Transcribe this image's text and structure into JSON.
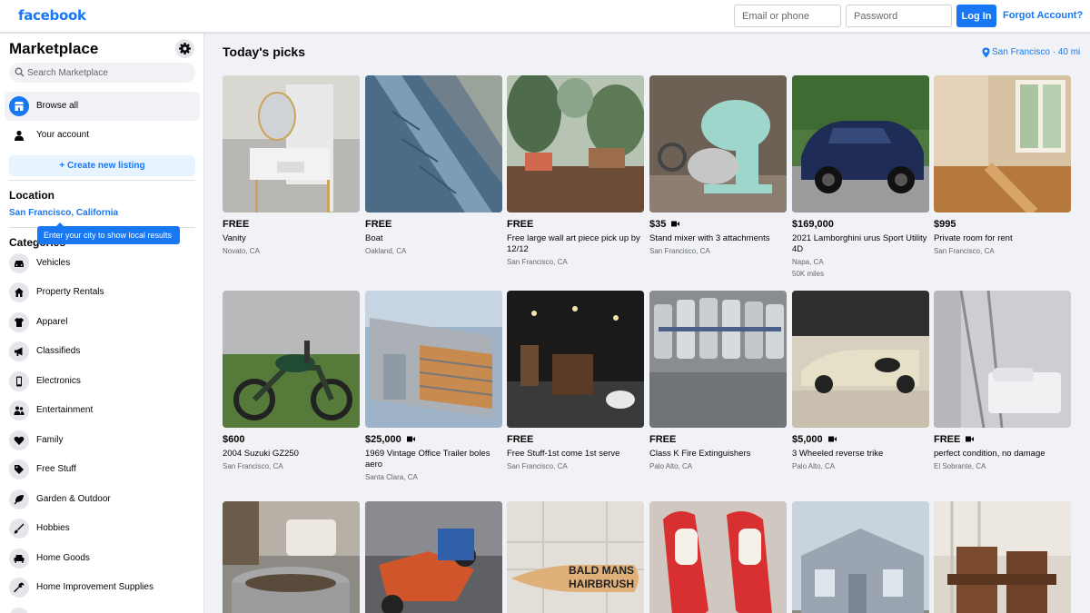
{
  "header": {
    "logo": "facebook",
    "email_placeholder": "Email or phone",
    "password_placeholder": "Password",
    "login_label": "Log In",
    "forgot_label": "Forgot Account?"
  },
  "sidebar": {
    "title": "Marketplace",
    "search_placeholder": "Search Marketplace",
    "nav": [
      {
        "label": "Browse all",
        "icon": "storefront-icon"
      },
      {
        "label": "Your account",
        "icon": "person-icon"
      }
    ],
    "create_label": "+ Create new listing",
    "location_title": "Location",
    "location_value": "San Francisco, California",
    "tooltip": "Enter your city to show local results",
    "categories_title": "Categories",
    "categories": [
      {
        "label": "Vehicles",
        "icon": "car-icon"
      },
      {
        "label": "Property Rentals",
        "icon": "house-icon"
      },
      {
        "label": "Apparel",
        "icon": "shirt-icon"
      },
      {
        "label": "Classifieds",
        "icon": "megaphone-icon"
      },
      {
        "label": "Electronics",
        "icon": "phone-icon"
      },
      {
        "label": "Entertainment",
        "icon": "people-icon"
      },
      {
        "label": "Family",
        "icon": "heart-icon"
      },
      {
        "label": "Free Stuff",
        "icon": "tag-icon"
      },
      {
        "label": "Garden & Outdoor",
        "icon": "leaf-icon"
      },
      {
        "label": "Hobbies",
        "icon": "brush-icon"
      },
      {
        "label": "Home Goods",
        "icon": "sofa-icon"
      },
      {
        "label": "Home Improvement Supplies",
        "icon": "wrench-icon"
      }
    ]
  },
  "main": {
    "title": "Today's picks",
    "location_chip": "San Francisco · 40 mi",
    "listings": [
      {
        "price": "FREE",
        "title": "Vanity",
        "location": "Novato, CA",
        "video": false
      },
      {
        "price": "FREE",
        "title": "Boat",
        "location": "Oakland, CA",
        "video": false
      },
      {
        "price": "FREE",
        "title": "Free large wall art piece pick up by 12/12",
        "location": "San Francisco, CA",
        "video": false
      },
      {
        "price": "$35",
        "title": "Stand mixer with 3 attachments",
        "location": "San Francisco, CA",
        "video": true
      },
      {
        "price": "$169,000",
        "title": "2021 Lamborghini urus Sport Utility 4D",
        "location": "Napa, CA",
        "miles": "50K miles",
        "video": false
      },
      {
        "price": "$995",
        "title": "Private room for rent",
        "location": "San Francisco, CA",
        "video": false
      },
      {
        "price": "$600",
        "title": "2004 Suzuki GZ250",
        "location": "San Francisco, CA",
        "video": false
      },
      {
        "price": "$25,000",
        "title": "1969 Vintage Office Trailer boles aero",
        "location": "Santa Clara, CA",
        "video": true
      },
      {
        "price": "FREE",
        "title": "Free Stuff-1st come 1st serve",
        "location": "San Francisco, CA",
        "video": false
      },
      {
        "price": "FREE",
        "title": "Class K Fire Extinguishers",
        "location": "Palo Alto, CA",
        "video": false
      },
      {
        "price": "$5,000",
        "title": "3 Wheeled reverse trike",
        "location": "Palo Alto, CA",
        "video": true
      },
      {
        "price": "FREE",
        "title": "perfect condition, no damage",
        "location": "El Sobrante, CA",
        "video": true
      }
    ],
    "third_row_sign_text": "BALD MANS HAIRBRUSH"
  },
  "colors": {
    "brand": "#1877f2",
    "background": "#f0f2f5",
    "muted_text": "#65676b"
  }
}
